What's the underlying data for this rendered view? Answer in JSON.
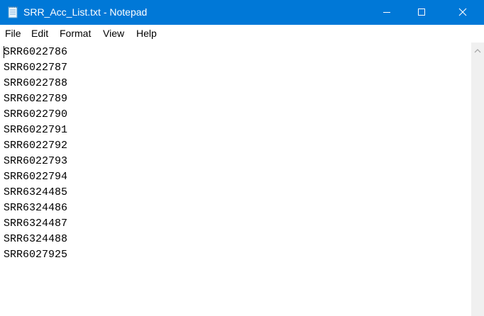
{
  "window": {
    "title": "SRR_Acc_List.txt - Notepad",
    "title_icon": "notepad-icon",
    "title_bar_color": "#0078d7",
    "controls": [
      "minimize-icon",
      "maximize-icon",
      "close-icon"
    ]
  },
  "menu": {
    "items": [
      {
        "label": "File"
      },
      {
        "label": "Edit"
      },
      {
        "label": "Format"
      },
      {
        "label": "View"
      },
      {
        "label": "Help"
      }
    ]
  },
  "document": {
    "lines": [
      "SRR6022786",
      "SRR6022787",
      "SRR6022788",
      "SRR6022789",
      "SRR6022790",
      "SRR6022791",
      "SRR6022792",
      "SRR6022793",
      "SRR6022794",
      "SRR6324485",
      "SRR6324486",
      "SRR6324487",
      "SRR6324488",
      "SRR6027925"
    ]
  },
  "scrollbar": {
    "up_icon": "scroll-up-arrow-icon"
  }
}
